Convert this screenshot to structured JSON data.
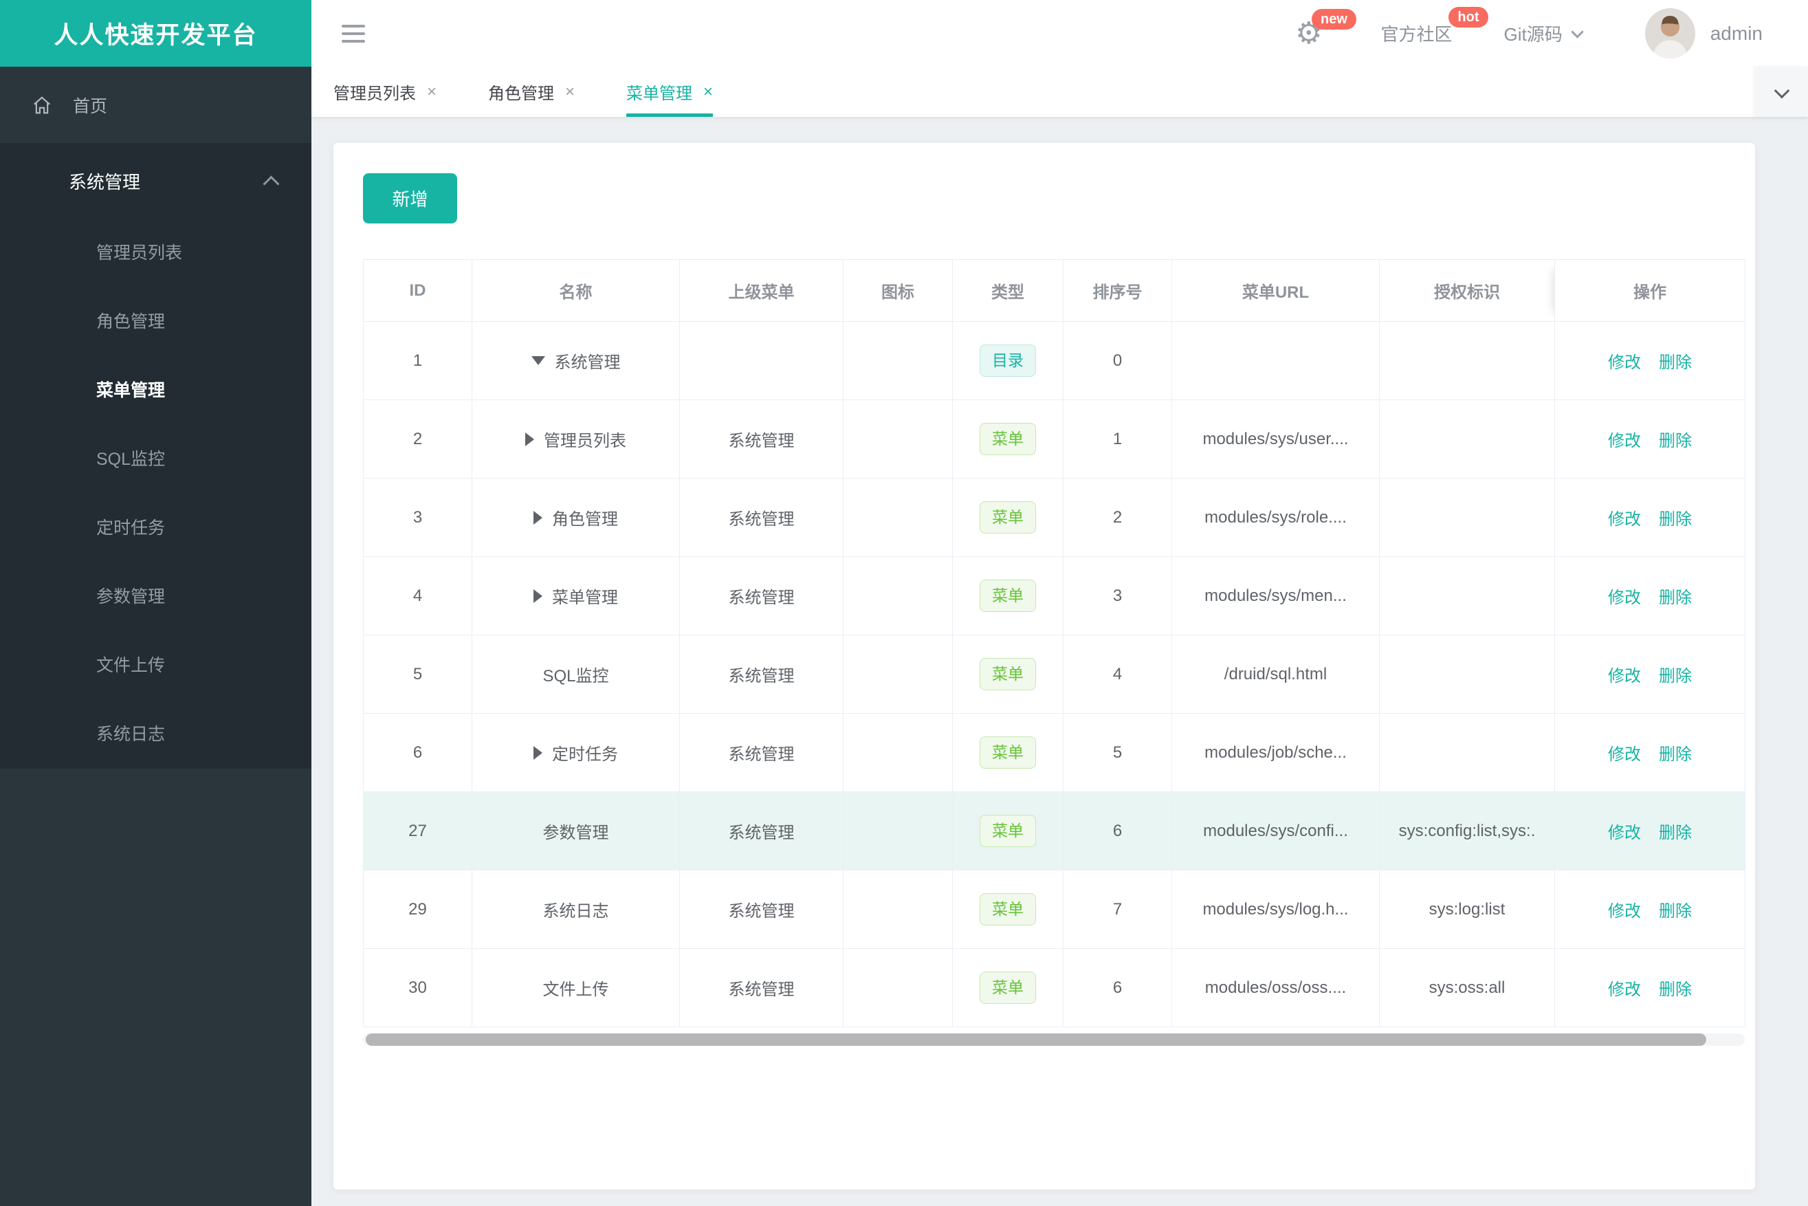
{
  "app": {
    "title": "人人快速开发平台",
    "accent_color": "#17b3a3"
  },
  "topbar": {
    "settings_badge": "new",
    "community_label": "官方社区",
    "community_badge": "hot",
    "git_label": "Git源码",
    "username": "admin",
    "badge_color": "#f96a5f",
    "gear_glyph": "⚙"
  },
  "sidebar": {
    "home_label": "首页",
    "group_title": "系统管理",
    "items": [
      "管理员列表",
      "角色管理",
      "菜单管理",
      "SQL监控",
      "定时任务",
      "参数管理",
      "文件上传",
      "系统日志"
    ],
    "active_item": "菜单管理"
  },
  "tabs": {
    "close_glyph": "×",
    "items": [
      {
        "label": "管理员列表"
      },
      {
        "label": "角色管理"
      },
      {
        "label": "菜单管理",
        "active": true
      }
    ]
  },
  "toolbar": {
    "add_label": "新增"
  },
  "table": {
    "columns": [
      "ID",
      "名称",
      "上级菜单",
      "图标",
      "类型",
      "排序号",
      "菜单URL",
      "授权标识",
      "操作"
    ],
    "badge_labels": {
      "dir": "目录",
      "menu": "菜单"
    },
    "badge_colors": {
      "dir": "#17b3a3",
      "menu": "#67c23a"
    },
    "highlight_color": "#e9f5f3",
    "actions": {
      "edit": "修改",
      "delete": "删除"
    },
    "rows": [
      {
        "id": "1",
        "arrow": "down",
        "name": "系统管理",
        "parent": "",
        "type": "dir",
        "order": "0",
        "url": "",
        "perm": ""
      },
      {
        "id": "2",
        "arrow": "right",
        "name": "管理员列表",
        "parent": "系统管理",
        "type": "menu",
        "order": "1",
        "url": "modules/sys/user....",
        "perm": ""
      },
      {
        "id": "3",
        "arrow": "right",
        "name": "角色管理",
        "parent": "系统管理",
        "type": "menu",
        "order": "2",
        "url": "modules/sys/role....",
        "perm": ""
      },
      {
        "id": "4",
        "arrow": "right",
        "name": "菜单管理",
        "parent": "系统管理",
        "type": "menu",
        "order": "3",
        "url": "modules/sys/men...",
        "perm": ""
      },
      {
        "id": "5",
        "arrow": "",
        "name": "SQL监控",
        "parent": "系统管理",
        "type": "menu",
        "order": "4",
        "url": "/druid/sql.html",
        "perm": ""
      },
      {
        "id": "6",
        "arrow": "right",
        "name": "定时任务",
        "parent": "系统管理",
        "type": "menu",
        "order": "5",
        "url": "modules/job/sche...",
        "perm": ""
      },
      {
        "id": "27",
        "arrow": "",
        "name": "参数管理",
        "parent": "系统管理",
        "type": "menu",
        "order": "6",
        "url": "modules/sys/confi...",
        "perm": "sys:config:list,sys:.",
        "highlighted": true
      },
      {
        "id": "29",
        "arrow": "",
        "name": "系统日志",
        "parent": "系统管理",
        "type": "menu",
        "order": "7",
        "url": "modules/sys/log.h...",
        "perm": "sys:log:list"
      },
      {
        "id": "30",
        "arrow": "",
        "name": "文件上传",
        "parent": "系统管理",
        "type": "menu",
        "order": "6",
        "url": "modules/oss/oss....",
        "perm": "sys:oss:all"
      }
    ]
  }
}
